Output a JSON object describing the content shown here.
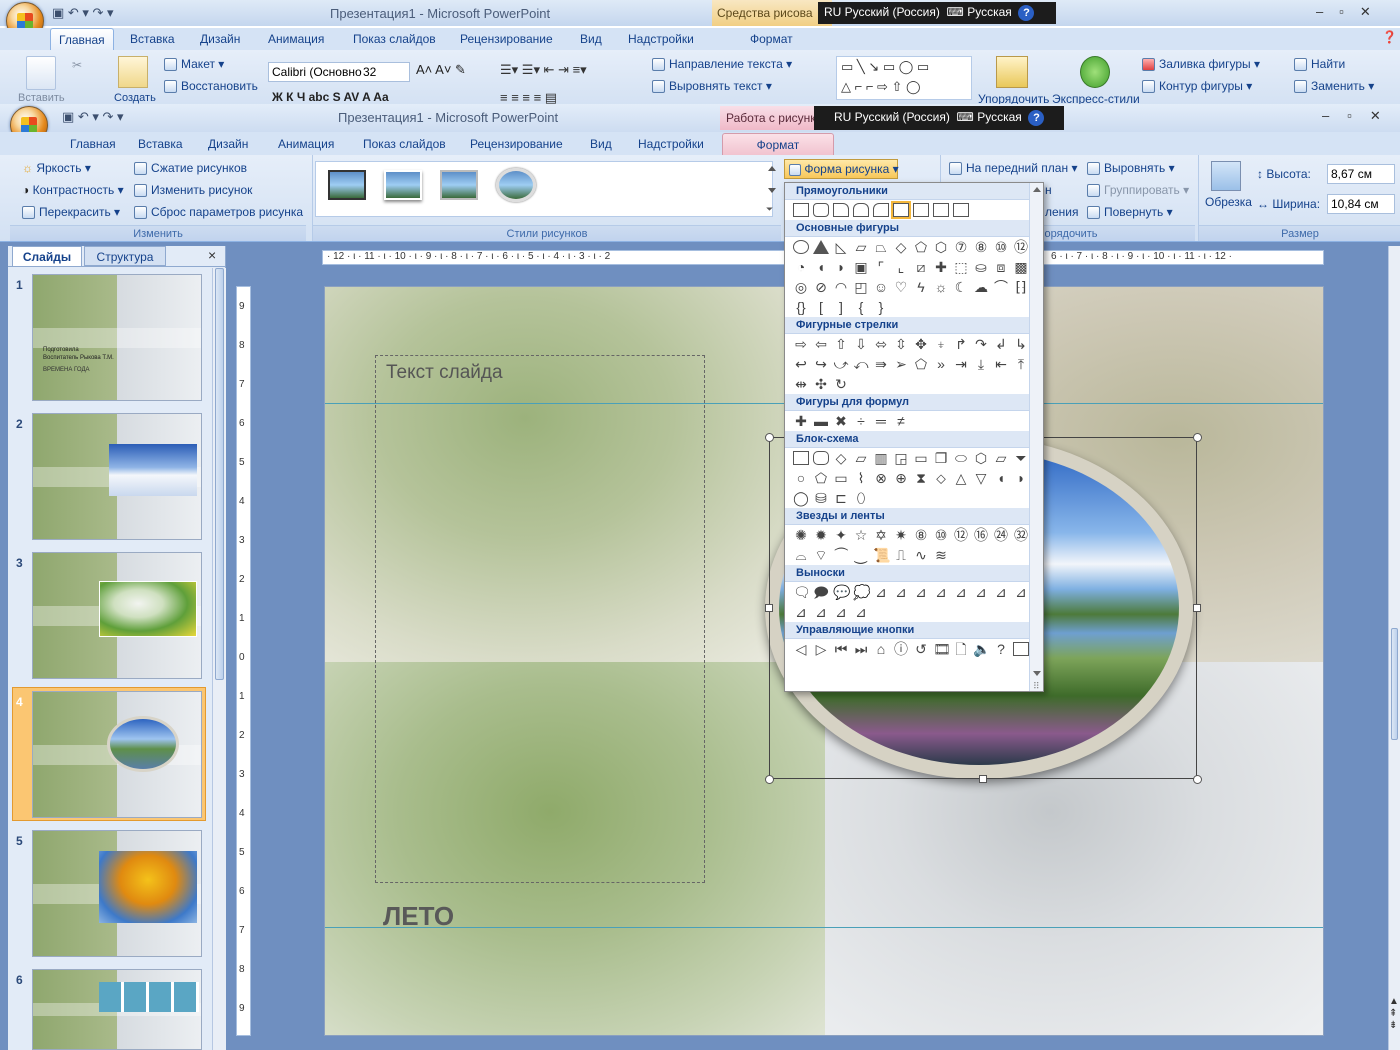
{
  "window1": {
    "title": "Презентация1 - Microsoft PowerPoint",
    "context_tab": "Средства рисова",
    "tabs": [
      "Главная",
      "Вставка",
      "Дизайн",
      "Анимация",
      "Показ слайдов",
      "Рецензирование",
      "Вид",
      "Надстройки",
      "Формат"
    ],
    "lang": "RU Русский (Россия)",
    "keyboard": "Русская",
    "help": "?",
    "clipboard": {
      "paste": "Вставить"
    },
    "slides_group": {
      "create": "Создать",
      "layout": "Макет",
      "restore": "Восстановить"
    },
    "font": {
      "name": "Calibri (Основно",
      "size": "32"
    },
    "paragraph": {
      "text_direction": "Направление текста",
      "align_text": "Выровнять текст"
    },
    "drawing": {
      "arrange": "Упорядочить",
      "quick_styles": "Экспресс-стили",
      "fill": "Заливка фигуры",
      "outline": "Контур фигуры"
    },
    "editing": {
      "find": "Найти",
      "replace": "Заменить"
    }
  },
  "window2": {
    "title": "Презентация1 - Microsoft PowerPoint",
    "context_tab": "Работа с рисунк",
    "tabs": [
      "Главная",
      "Вставка",
      "Дизайн",
      "Анимация",
      "Показ слайдов",
      "Рецензирование",
      "Вид",
      "Надстройки",
      "Формат"
    ],
    "lang": "RU Русский (Россия)",
    "keyboard": "Русская",
    "help": "?"
  },
  "format_ribbon": {
    "adjust": {
      "brightness": "Яркость",
      "contrast": "Контрастность",
      "recolor": "Перекрасить",
      "compress": "Сжатие рисунков",
      "change": "Изменить рисунок",
      "reset": "Сброс параметров рисунка",
      "label": "Изменить"
    },
    "styles": {
      "label": "Стили рисунков",
      "shape_button": "Форма рисунка"
    },
    "arrange": {
      "bring_front": "На передний план",
      "align": "Выровнять",
      "group": "Группировать",
      "rotate": "Повернуть",
      "partial1": "н",
      "partial2": "ления",
      "label": "порядочить"
    },
    "size": {
      "crop": "Обрезка",
      "height_label": "Высота:",
      "height_value": "8,67 см",
      "width_label": "Ширина:",
      "width_value": "10,84 см",
      "label": "Размер"
    }
  },
  "shape_menu": {
    "sections": [
      {
        "title": "Прямоугольники"
      },
      {
        "title": "Основные фигуры"
      },
      {
        "title": "Фигурные стрелки"
      },
      {
        "title": "Фигуры для формул"
      },
      {
        "title": "Блок-схема"
      },
      {
        "title": "Звезды и ленты"
      },
      {
        "title": "Выноски"
      },
      {
        "title": "Управляющие кнопки"
      }
    ]
  },
  "panel": {
    "tab_slides": "Слайды",
    "tab_outline": "Структура",
    "close": "×",
    "slides": [
      {
        "num": "1",
        "text1": "Подготовила",
        "text2": "Воспитатель Рыкова Т.М.",
        "text3": "ВРЕМЕНА ГОДА"
      },
      {
        "num": "2"
      },
      {
        "num": "3"
      },
      {
        "num": "4"
      },
      {
        "num": "5"
      },
      {
        "num": "6"
      }
    ]
  },
  "ruler": {
    "h_left": "· 12 · ι · 11 · ι · 10 · ι · 9 · ι · 8 · ι · 7 · ι · 6 · ι · 5 · ι · 4 · ι · 3 · ι · 2",
    "h_right": "6 · ι · 7 · ι · 8 · ι · 9 · ι · 10 · ι · 11 · ι · 12 ·",
    "v_marks": [
      "9",
      "8",
      "7",
      "6",
      "5",
      "4",
      "3",
      "2",
      "1",
      "0",
      "1",
      "2",
      "3",
      "4",
      "5",
      "6",
      "7",
      "8",
      "9"
    ]
  },
  "slide": {
    "text_placeholder": "Текст слайда",
    "season_title": "ЛЕТО"
  }
}
